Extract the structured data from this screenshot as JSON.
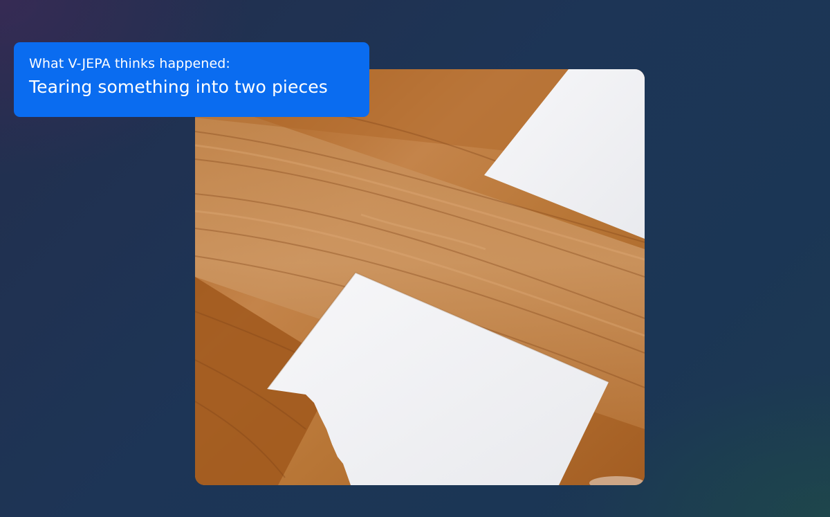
{
  "caption": {
    "subtitle": "What V-JEPA thinks happened:",
    "title": "Tearing something into two pieces"
  },
  "video": {
    "scene": "two torn pieces of white paper on a wooden table",
    "colors": {
      "wood_light": "#c98a4a",
      "wood_dark": "#8e4f1f",
      "paper": "#f3f4f6",
      "accent": "#0a6cf0"
    }
  }
}
